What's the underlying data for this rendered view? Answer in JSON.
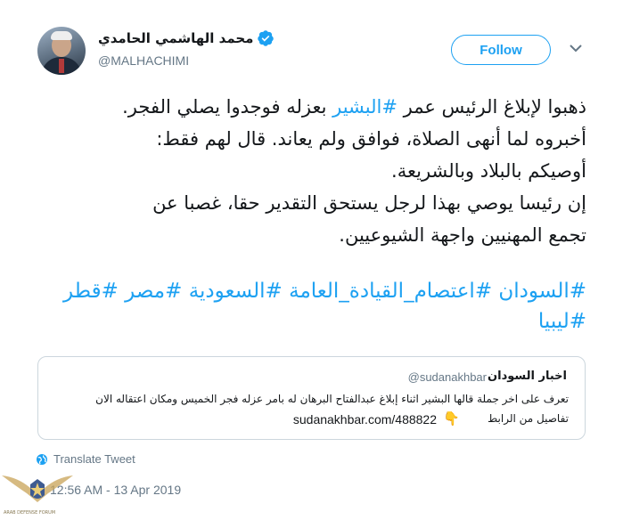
{
  "author": {
    "display_name": "محمد الهاشمي الحامدي",
    "handle": "@MALHACHIMI",
    "verified": true
  },
  "header": {
    "follow_label": "Follow",
    "menu_icon": "chevron-down-icon"
  },
  "tweet": {
    "line1_a": "ذهبوا لإبلاغ الرئيس عمر ",
    "line1_tag": "#البشير",
    "line1_b": " بعزله فوجدوا يصلي الفجر.",
    "line2": "أخبروه لما أنهى الصلاة، فوافق ولم يعاند. قال لهم فقط:",
    "line3": "أوصيكم بالبلاد وبالشريعة.",
    "line4": "إن رئيسا يوصي بهذا لرجل يستحق التقدير حقا، غصبا عن",
    "line5": "تجمع المهنيين واجهة الشيوعيين.",
    "hashtags_line1": "#السودان #اعتصام_القيادة_العامة #السعودية #مصر #قطر",
    "hashtags_line2": "#ليبيا"
  },
  "quoted_tweet": {
    "name": "اخبار السودان",
    "handle": "@sudanakhbar",
    "text": "تعرف على اخر جملة قالها البشير اثناء إبلاغ عبدالفتاح البرهان له بامر عزله فجر الخميس ومكان اعتقاله الان",
    "link_prefix": "تفاصيل من الرابط",
    "pointing_icon": "👇",
    "url": "sudanakhbar.com/488822"
  },
  "actions": {
    "translate_label": "Translate Tweet",
    "translate_icon": "globe-icon"
  },
  "meta": {
    "timestamp": "12:56 AM - 13 Apr 2019"
  },
  "watermark": {
    "text": "ARAB DEFENSE FORUM"
  },
  "colors": {
    "accent": "#1da1f2",
    "secondary_text": "#657786",
    "border": "#ccd6dd"
  }
}
